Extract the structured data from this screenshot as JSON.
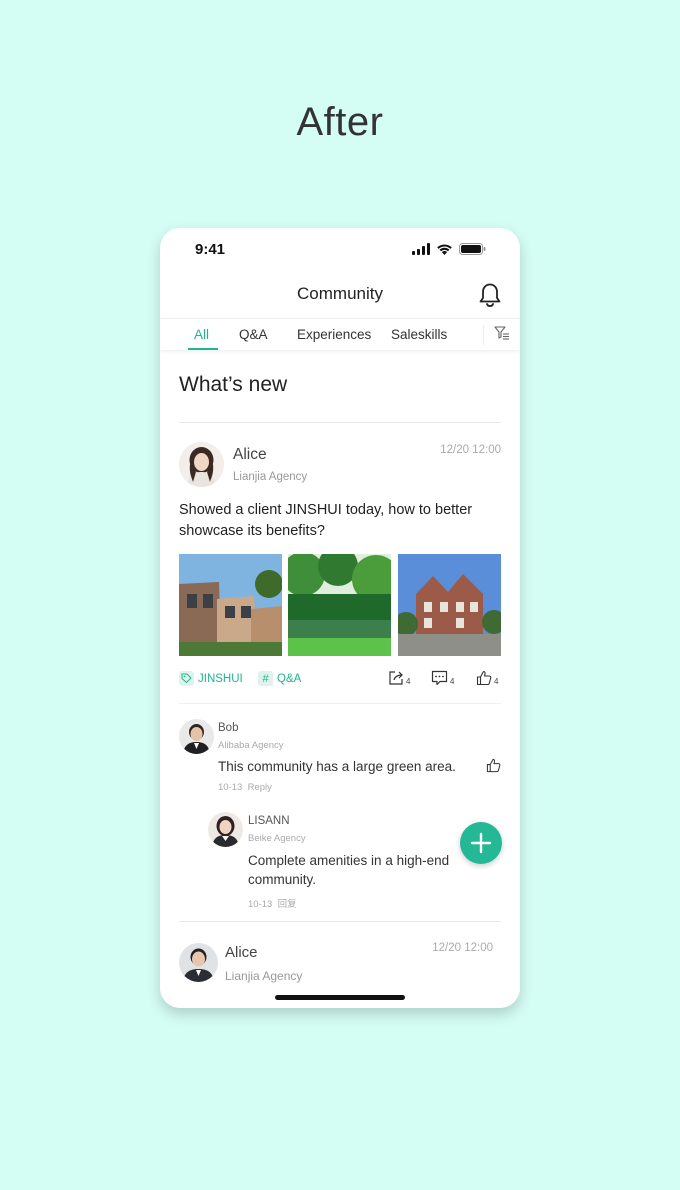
{
  "heading": "After",
  "status_bar": {
    "time": "9:41"
  },
  "nav": {
    "title": "Community"
  },
  "tabs": [
    {
      "label": "All",
      "active": true
    },
    {
      "label": "Q&A",
      "active": false
    },
    {
      "label": "Experiences",
      "active": false
    },
    {
      "label": "Saleskills",
      "active": false
    }
  ],
  "section_title": "What’s new",
  "post": {
    "author": "Alice",
    "agency": "Lianjia Agency",
    "date": "12/20 12:00",
    "text": "Showed a client JINSHUI today, how to better showcase its benefits?",
    "tags": [
      {
        "icon": "tag-icon",
        "label": "JINSHUI"
      },
      {
        "icon": "hash-icon",
        "label": "Q&A"
      }
    ],
    "actions": {
      "share_count": "4",
      "comment_count": "4",
      "like_count": "4"
    }
  },
  "comments": [
    {
      "name": "Bob",
      "agency": "Alibaba Agency",
      "text": "This community has a large green area.",
      "date": "10-13",
      "reply": "Reply"
    },
    {
      "name": "LISANN",
      "agency": "Beike Agency",
      "text_line1": "Complete amenities in a high-end",
      "text_line2": "community.",
      "date": "10-13",
      "reply": "回复"
    }
  ],
  "next_post": {
    "author": "Alice",
    "agency": "Lianjia Agency",
    "date": "12/20 12:00"
  },
  "colors": {
    "accent": "#1fb58f",
    "background": "#d4fdf4",
    "fab": "#24b896"
  }
}
